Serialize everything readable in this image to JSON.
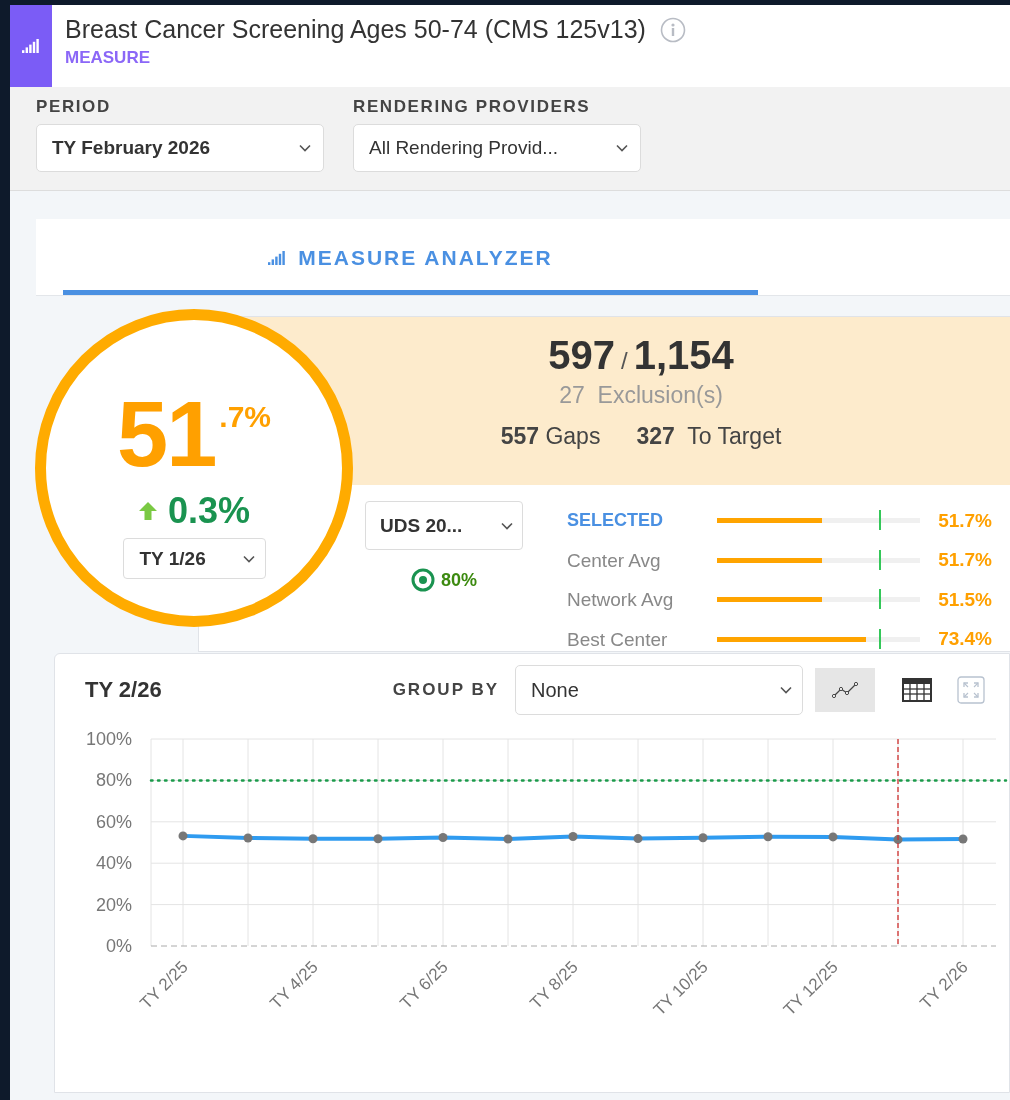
{
  "header": {
    "title": "Breast Cancer Screening Ages 50-74 (CMS 125v13)",
    "subtitle": "MEASURE"
  },
  "filters": [
    {
      "label": "PERIOD",
      "value": "TY February 2026",
      "emphasized": true
    },
    {
      "label": "RENDERING PROVIDERS",
      "value": "All Rendering Provid...",
      "emphasized": false
    }
  ],
  "tabs": [
    {
      "label": "MEASURE ANALYZER",
      "selected": true
    }
  ],
  "score": {
    "whole": "51",
    "fraction": ".7%",
    "change": "0.3%",
    "period": "TY 1/26"
  },
  "counts": {
    "numerator": "597",
    "separator": "/",
    "denominator": "1,154",
    "exclusions_count": "27",
    "exclusions_label": "Exclusion(s)",
    "gaps_count": "557",
    "gaps_label": "Gaps",
    "to_target_count": "327",
    "to_target_label": "To Target"
  },
  "benchmark": {
    "value": "UDS 20...",
    "target": "80%"
  },
  "comparisons": [
    {
      "label": "SELECTED",
      "selected": true,
      "level": 0.517,
      "reading": "51.7%"
    },
    {
      "label": "Center Avg",
      "selected": false,
      "level": 0.517,
      "reading": "51.7%"
    },
    {
      "label": "Network Avg",
      "selected": false,
      "level": 0.515,
      "reading": "51.5%"
    },
    {
      "label": "Best Center",
      "selected": false,
      "level": 0.734,
      "reading": "73.4%"
    }
  ],
  "chart_panel": {
    "title": "TY 2/26",
    "group_by_label": "GROUP BY",
    "group_by": "None",
    "views": [
      {
        "kind": "line",
        "selected": true
      },
      {
        "kind": "table",
        "selected": false
      }
    ],
    "chart_data": {
      "type": "line",
      "categories": [
        "TY 2/25",
        null,
        "TY 4/25",
        null,
        "TY 6/25",
        null,
        "TY 8/25",
        null,
        "TY 10/25",
        null,
        "TY 12/25",
        null,
        "TY 2/26"
      ],
      "series": [
        {
          "color": "#2f9bf0",
          "marker": true,
          "values": [
            53.2,
            52.2,
            51.8,
            51.8,
            52.4,
            51.7,
            52.9,
            51.9,
            52.3,
            52.8,
            52.7,
            51.4,
            51.7
          ]
        }
      ],
      "ylim": [
        0,
        100
      ],
      "yticks": [
        {
          "value": 0,
          "label": "0%"
        },
        {
          "value": 20,
          "label": "20%"
        },
        {
          "value": 40,
          "label": "40%"
        },
        {
          "value": 60,
          "label": "60%"
        },
        {
          "value": 80,
          "label": "80%"
        },
        {
          "value": 100,
          "label": "100%"
        }
      ],
      "grid": true,
      "ref_lines": [
        {
          "axis": "y",
          "value": 80
        }
      ]
    }
  }
}
